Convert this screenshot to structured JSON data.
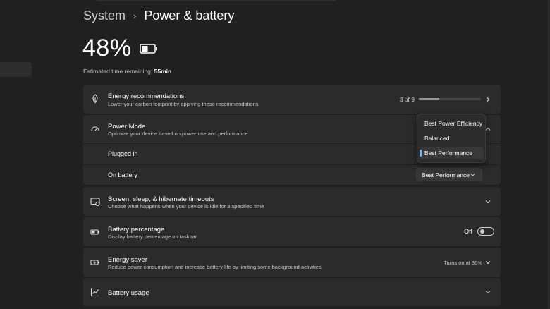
{
  "breadcrumb": {
    "parent": "System",
    "separator": "›",
    "current": "Power & battery"
  },
  "battery": {
    "percent_text": "48%",
    "level": 0.48,
    "estimate_label": "Estimated time remaining:",
    "estimate_value": "55min"
  },
  "energy_recommendations": {
    "title": "Energy recommendations",
    "subtitle": "Lower your carbon footprint by applying these recommendations",
    "progress_text": "3 of 9",
    "progress_fraction": 0.333
  },
  "power_mode": {
    "title": "Power Mode",
    "subtitle": "Optimize your device based on power use and performance",
    "plugged_in_label": "Plugged in",
    "on_battery_label": "On battery",
    "on_battery_value": "Best Performance",
    "options": [
      "Best Power Efficiency",
      "Balanced",
      "Best Performance"
    ],
    "selected_option": "Best Performance"
  },
  "screen_sleep": {
    "title": "Screen, sleep, & hibernate timeouts",
    "subtitle": "Choose what happens when your device is idle for a specified time"
  },
  "battery_percentage": {
    "title": "Battery percentage",
    "subtitle": "Display battery percentage on taskbar",
    "toggle_label": "Off",
    "toggle_on": false
  },
  "energy_saver": {
    "title": "Energy saver",
    "subtitle": "Reduce power consumption and increase battery life by limiting some background activities",
    "status": "Turns on at 30%"
  },
  "battery_usage": {
    "title": "Battery usage"
  },
  "colors": {
    "accent": "#76b9ed",
    "card": "#2b2b2b",
    "background": "#202020"
  }
}
